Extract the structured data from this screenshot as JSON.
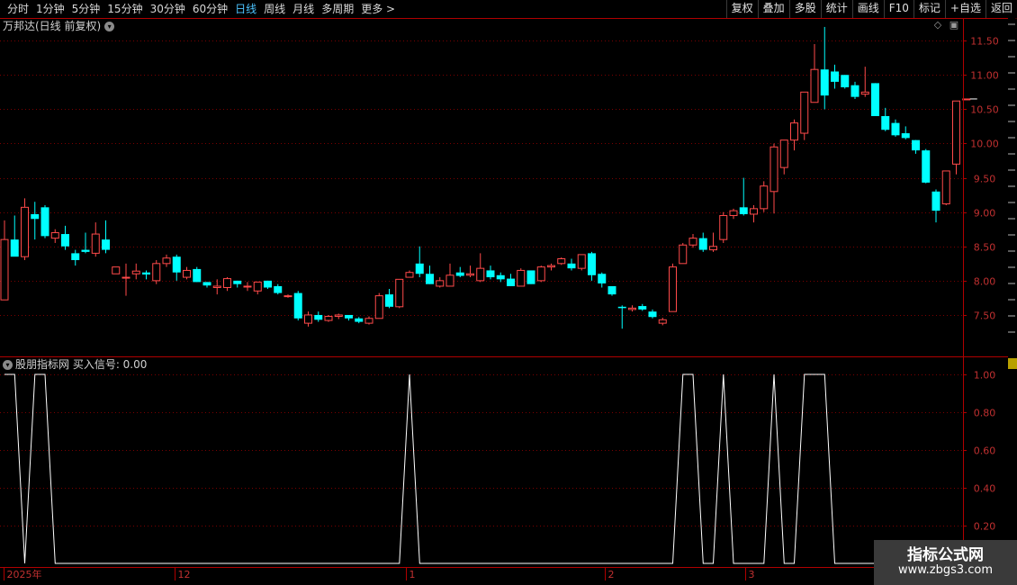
{
  "toolbar": {
    "periods": [
      "分时",
      "1分钟",
      "5分钟",
      "15分钟",
      "30分钟",
      "60分钟",
      "日线",
      "周线",
      "月线",
      "多周期",
      "更多 >"
    ],
    "active_period": "日线",
    "right_buttons": [
      "复权",
      "叠加",
      "多股",
      "统计",
      "画线",
      "F10",
      "标记",
      "+自选",
      "返回"
    ]
  },
  "price_panel": {
    "title": "万邦达(日线 前复权)",
    "price_axis_labels": [
      "11.50",
      "11.00",
      "10.50",
      "10.00",
      "9.50",
      "9.00",
      "8.50",
      "8.00",
      "7.50"
    ]
  },
  "indicator_panel": {
    "title": "股朋指标网 买入信号: 0.00",
    "axis_labels": [
      "1.00",
      "0.80",
      "0.60",
      "0.40",
      "0.20"
    ]
  },
  "time_axis": {
    "labels": [
      "2025年",
      "12",
      "1",
      "2",
      "3"
    ]
  },
  "watermark": {
    "line1": "指标公式网",
    "line2": "www.zbgs3.com"
  },
  "colors": {
    "up": "#ff4a4a",
    "down": "#00ffff",
    "grid": "#7a0000",
    "axis": "#b00000",
    "signal": "#ffffff"
  },
  "chart_data": [
    {
      "type": "candlestick",
      "title": "万邦达(日线 前复权)",
      "ylim": [
        7.1,
        11.85
      ],
      "candles": [
        {
          "o": 7.72,
          "h": 8.88,
          "l": 7.72,
          "c": 8.6
        },
        {
          "o": 8.6,
          "h": 8.95,
          "l": 8.5,
          "c": 8.35
        },
        {
          "o": 8.35,
          "h": 9.2,
          "l": 8.3,
          "c": 9.07
        },
        {
          "o": 8.97,
          "h": 9.15,
          "l": 8.6,
          "c": 8.9
        },
        {
          "o": 9.07,
          "h": 9.1,
          "l": 8.62,
          "c": 8.65
        },
        {
          "o": 8.62,
          "h": 8.75,
          "l": 8.55,
          "c": 8.7
        },
        {
          "o": 8.68,
          "h": 8.8,
          "l": 8.45,
          "c": 8.5
        },
        {
          "o": 8.4,
          "h": 8.45,
          "l": 8.22,
          "c": 8.3
        },
        {
          "o": 8.45,
          "h": 8.7,
          "l": 8.4,
          "c": 8.42
        },
        {
          "o": 8.4,
          "h": 8.85,
          "l": 8.35,
          "c": 8.68
        },
        {
          "o": 8.6,
          "h": 8.88,
          "l": 8.4,
          "c": 8.45
        },
        {
          "o": 8.1,
          "h": 8.2,
          "l": 8.1,
          "c": 8.2
        },
        {
          "o": 8.05,
          "h": 8.25,
          "l": 7.78,
          "c": 8.05
        },
        {
          "o": 8.1,
          "h": 8.25,
          "l": 8.02,
          "c": 8.14
        },
        {
          "o": 8.12,
          "h": 8.15,
          "l": 8.02,
          "c": 8.09
        },
        {
          "o": 8.0,
          "h": 8.3,
          "l": 7.95,
          "c": 8.25
        },
        {
          "o": 8.25,
          "h": 8.38,
          "l": 8.2,
          "c": 8.33
        },
        {
          "o": 8.35,
          "h": 8.38,
          "l": 8.0,
          "c": 8.12
        },
        {
          "o": 8.05,
          "h": 8.2,
          "l": 8.02,
          "c": 8.15
        },
        {
          "o": 8.17,
          "h": 8.2,
          "l": 7.98,
          "c": 7.98
        },
        {
          "o": 7.98,
          "h": 7.98,
          "l": 7.9,
          "c": 7.93
        },
        {
          "o": 7.9,
          "h": 8.02,
          "l": 7.8,
          "c": 7.92
        },
        {
          "o": 7.9,
          "h": 8.05,
          "l": 7.85,
          "c": 8.03
        },
        {
          "o": 8.0,
          "h": 8.0,
          "l": 7.9,
          "c": 7.95
        },
        {
          "o": 7.92,
          "h": 7.98,
          "l": 7.85,
          "c": 7.92
        },
        {
          "o": 7.85,
          "h": 7.98,
          "l": 7.8,
          "c": 7.98
        },
        {
          "o": 8.0,
          "h": 8.0,
          "l": 7.88,
          "c": 7.9
        },
        {
          "o": 7.92,
          "h": 7.95,
          "l": 7.8,
          "c": 7.82
        },
        {
          "o": 7.78,
          "h": 7.8,
          "l": 7.75,
          "c": 7.78
        },
        {
          "o": 7.82,
          "h": 7.85,
          "l": 7.42,
          "c": 7.45
        },
        {
          "o": 7.38,
          "h": 7.55,
          "l": 7.33,
          "c": 7.5
        },
        {
          "o": 7.5,
          "h": 7.55,
          "l": 7.4,
          "c": 7.43
        },
        {
          "o": 7.42,
          "h": 7.5,
          "l": 7.4,
          "c": 7.48
        },
        {
          "o": 7.48,
          "h": 7.52,
          "l": 7.44,
          "c": 7.5
        },
        {
          "o": 7.5,
          "h": 7.5,
          "l": 7.42,
          "c": 7.45
        },
        {
          "o": 7.45,
          "h": 7.47,
          "l": 7.38,
          "c": 7.4
        },
        {
          "o": 7.38,
          "h": 7.48,
          "l": 7.36,
          "c": 7.45
        },
        {
          "o": 7.45,
          "h": 7.82,
          "l": 7.45,
          "c": 7.78
        },
        {
          "o": 7.8,
          "h": 7.88,
          "l": 7.6,
          "c": 7.62
        },
        {
          "o": 7.62,
          "h": 8.02,
          "l": 7.6,
          "c": 8.02
        },
        {
          "o": 8.05,
          "h": 8.15,
          "l": 8.05,
          "c": 8.12
        },
        {
          "o": 8.25,
          "h": 8.5,
          "l": 8.05,
          "c": 8.1
        },
        {
          "o": 8.1,
          "h": 8.22,
          "l": 7.95,
          "c": 7.95
        },
        {
          "o": 7.92,
          "h": 8.05,
          "l": 7.9,
          "c": 8.0
        },
        {
          "o": 7.92,
          "h": 8.25,
          "l": 7.92,
          "c": 8.08
        },
        {
          "o": 8.12,
          "h": 8.2,
          "l": 8.05,
          "c": 8.07
        },
        {
          "o": 8.08,
          "h": 8.22,
          "l": 8.05,
          "c": 8.1
        },
        {
          "o": 8.0,
          "h": 8.4,
          "l": 7.98,
          "c": 8.18
        },
        {
          "o": 8.15,
          "h": 8.22,
          "l": 8.02,
          "c": 8.05
        },
        {
          "o": 8.08,
          "h": 8.12,
          "l": 7.98,
          "c": 8.02
        },
        {
          "o": 8.03,
          "h": 8.1,
          "l": 7.92,
          "c": 7.92
        },
        {
          "o": 7.92,
          "h": 8.18,
          "l": 7.92,
          "c": 8.15
        },
        {
          "o": 8.15,
          "h": 8.15,
          "l": 7.95,
          "c": 7.95
        },
        {
          "o": 8.0,
          "h": 8.22,
          "l": 7.98,
          "c": 8.2
        },
        {
          "o": 8.2,
          "h": 8.25,
          "l": 8.15,
          "c": 8.22
        },
        {
          "o": 8.25,
          "h": 8.34,
          "l": 8.23,
          "c": 8.32
        },
        {
          "o": 8.25,
          "h": 8.32,
          "l": 8.15,
          "c": 8.18
        },
        {
          "o": 8.18,
          "h": 8.38,
          "l": 8.15,
          "c": 8.38
        },
        {
          "o": 8.4,
          "h": 8.42,
          "l": 8.0,
          "c": 8.08
        },
        {
          "o": 8.1,
          "h": 8.12,
          "l": 7.9,
          "c": 7.96
        },
        {
          "o": 7.92,
          "h": 7.92,
          "l": 7.78,
          "c": 7.8
        },
        {
          "o": 7.62,
          "h": 7.64,
          "l": 7.3,
          "c": 7.6
        },
        {
          "o": 7.58,
          "h": 7.64,
          "l": 7.55,
          "c": 7.6
        },
        {
          "o": 7.63,
          "h": 7.66,
          "l": 7.56,
          "c": 7.58
        },
        {
          "o": 7.55,
          "h": 7.58,
          "l": 7.45,
          "c": 7.47
        },
        {
          "o": 7.38,
          "h": 7.46,
          "l": 7.35,
          "c": 7.43
        },
        {
          "o": 7.55,
          "h": 8.25,
          "l": 7.55,
          "c": 8.2
        },
        {
          "o": 8.25,
          "h": 8.55,
          "l": 8.25,
          "c": 8.52
        },
        {
          "o": 8.52,
          "h": 8.68,
          "l": 8.48,
          "c": 8.62
        },
        {
          "o": 8.62,
          "h": 8.7,
          "l": 8.42,
          "c": 8.45
        },
        {
          "o": 8.45,
          "h": 8.7,
          "l": 8.42,
          "c": 8.5
        },
        {
          "o": 8.6,
          "h": 9.0,
          "l": 8.55,
          "c": 8.95
        },
        {
          "o": 8.95,
          "h": 9.05,
          "l": 8.9,
          "c": 9.02
        },
        {
          "o": 9.07,
          "h": 9.5,
          "l": 8.95,
          "c": 8.97
        },
        {
          "o": 8.97,
          "h": 9.1,
          "l": 8.85,
          "c": 9.05
        },
        {
          "o": 9.05,
          "h": 9.45,
          "l": 9.0,
          "c": 9.38
        },
        {
          "o": 9.3,
          "h": 10.0,
          "l": 8.98,
          "c": 9.95
        },
        {
          "o": 9.65,
          "h": 10.05,
          "l": 9.55,
          "c": 10.05
        },
        {
          "o": 10.05,
          "h": 10.35,
          "l": 9.9,
          "c": 10.3
        },
        {
          "o": 10.15,
          "h": 10.75,
          "l": 10.05,
          "c": 10.75
        },
        {
          "o": 10.6,
          "h": 11.45,
          "l": 10.6,
          "c": 11.08
        },
        {
          "o": 11.08,
          "h": 11.7,
          "l": 10.5,
          "c": 10.7
        },
        {
          "o": 11.05,
          "h": 11.15,
          "l": 10.8,
          "c": 10.9
        },
        {
          "o": 11.0,
          "h": 11.0,
          "l": 10.8,
          "c": 10.82
        },
        {
          "o": 10.85,
          "h": 10.9,
          "l": 10.65,
          "c": 10.68
        },
        {
          "o": 10.72,
          "h": 11.12,
          "l": 10.68,
          "c": 10.75
        },
        {
          "o": 10.88,
          "h": 10.88,
          "l": 10.4,
          "c": 10.4
        },
        {
          "o": 10.4,
          "h": 10.52,
          "l": 10.18,
          "c": 10.2
        },
        {
          "o": 10.3,
          "h": 10.35,
          "l": 10.1,
          "c": 10.12
        },
        {
          "o": 10.15,
          "h": 10.25,
          "l": 10.06,
          "c": 10.08
        },
        {
          "o": 10.05,
          "h": 10.05,
          "l": 9.85,
          "c": 9.9
        },
        {
          "o": 9.9,
          "h": 9.92,
          "l": 9.42,
          "c": 9.43
        },
        {
          "o": 9.3,
          "h": 9.33,
          "l": 8.85,
          "c": 9.02
        },
        {
          "o": 9.12,
          "h": 9.6,
          "l": 9.1,
          "c": 9.6
        },
        {
          "o": 9.7,
          "h": 10.62,
          "l": 9.55,
          "c": 10.62
        },
        {
          "o": 10.65,
          "h": 10.65,
          "l": 10.65,
          "c": 10.65
        }
      ]
    },
    {
      "type": "line",
      "title": "股朋指标网 买入信号",
      "ylim": [
        0,
        1.05
      ],
      "series": [
        {
          "name": "买入信号",
          "values": [
            1,
            1,
            0,
            1,
            1,
            0,
            0,
            0,
            0,
            0,
            0,
            0,
            0,
            0,
            0,
            0,
            0,
            0,
            0,
            0,
            0,
            0,
            0,
            0,
            0,
            0,
            0,
            0,
            0,
            0,
            0,
            0,
            0,
            0,
            0,
            0,
            0,
            0,
            0,
            0,
            1,
            0,
            0,
            0,
            0,
            0,
            0,
            0,
            0,
            0,
            0,
            0,
            0,
            0,
            0,
            0,
            0,
            0,
            0,
            0,
            0,
            0,
            0,
            0,
            0,
            0,
            0,
            1,
            1,
            0,
            0,
            1,
            0,
            0,
            0,
            0,
            1,
            0,
            0,
            1,
            1,
            1,
            0,
            0,
            0,
            0,
            0,
            0,
            0,
            0,
            0,
            0,
            0,
            0,
            0,
            0,
            0
          ]
        }
      ]
    }
  ]
}
